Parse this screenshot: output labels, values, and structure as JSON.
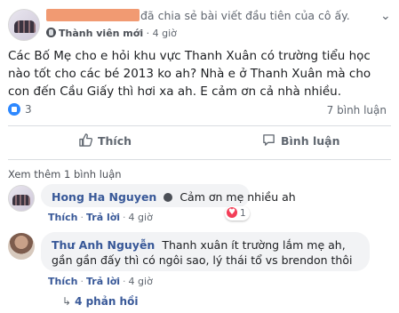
{
  "post": {
    "shared_text": "đã chia sẻ bài viết đầu tiên của cô ấy.",
    "role": "Thành viên mới",
    "time": "4 giờ",
    "separator": "·",
    "body": "Các Bố Mẹ cho e hỏi khu vực Thanh Xuân có trường tiểu học nào tốt cho các bé 2013 ko ah? Nhà e ở Thanh Xuân mà cho con đến Cầu Giấy thì hơi xa ah. E cảm ơn cả nhà nhiều.",
    "like_count": "3",
    "comment_count": "7 bình luận"
  },
  "actions": {
    "like_label": "Thích",
    "comment_label": "Bình luận"
  },
  "comments_section": {
    "see_more": "Xem thêm 1 bình luận",
    "comments": [
      {
        "author": "Hong Ha Nguyen",
        "text": "Cảm ơn mẹ nhiều ah",
        "like_label": "Thích",
        "reply_label": "Trả lời",
        "time": "4 giờ",
        "reaction_count": "1"
      },
      {
        "author": "Thư Anh Nguyễn",
        "text": "Thanh xuân ít trường lắm mẹ ah, gần gần đấy thì có ngôi sao, lý thái tổ vs brendon thôi",
        "like_label": "Thích",
        "reply_label": "Trả lời",
        "time": "4 giờ",
        "replies": "4 phản hồi"
      }
    ]
  },
  "colors": {
    "link": "#385898",
    "accent": "#2d88ff",
    "love": "#f33e58",
    "redaction": "#f19a72"
  }
}
